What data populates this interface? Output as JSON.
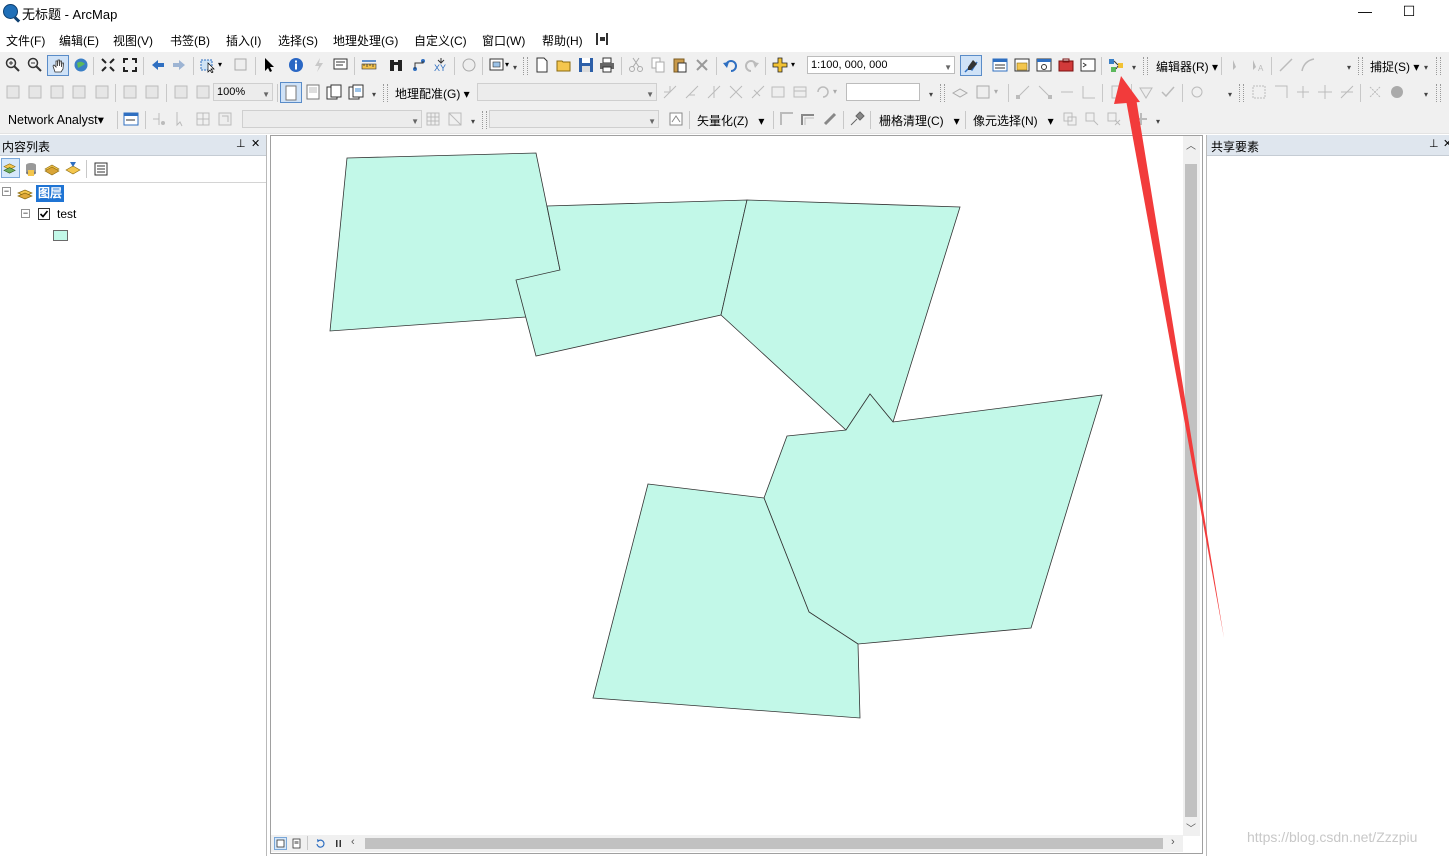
{
  "window": {
    "title": "无标题 - ArcMap",
    "minimize": "—",
    "maximize": "☐"
  },
  "menubar": {
    "items": [
      "文件(F)",
      "编辑(E)",
      "视图(V)",
      "书签(B)",
      "插入(I)",
      "选择(S)",
      "地理处理(G)",
      "自定义(C)",
      "窗口(W)",
      "帮助(H)"
    ]
  },
  "toolbar1": {
    "scale_value": "1:100, 000, 000",
    "editor_label": "编辑器(R)",
    "snapping_label": "捕捉(S)"
  },
  "toolbar2": {
    "zoom_value": "100%",
    "georef_label": "地理配准(G)"
  },
  "toolbar3": {
    "network_label": "Network Analyst",
    "vectorize_label": "矢量化(Z)",
    "raster_clean_label": "栅格清理(C)",
    "cell_select_label": "像元选择(N)"
  },
  "toc": {
    "title": "内容列表",
    "layers_label": "图层",
    "layer_name": "test",
    "symbol_color": "#c2f8e8"
  },
  "share_panel": {
    "title": "共享要素"
  },
  "map": {
    "polygon_fill": "#c2f8e8",
    "stroke": "#333333",
    "arrow_color": "#f23b3b"
  },
  "watermark": "https://blog.csdn.net/Zzzpiu"
}
